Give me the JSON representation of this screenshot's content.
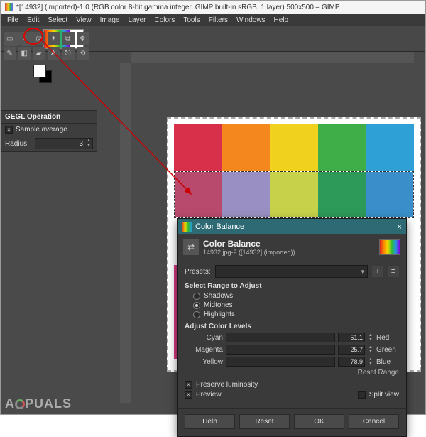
{
  "window": {
    "title": "*[14932] (imported)-1.0 (RGB color 8-bit gamma integer, GIMP built-in sRGB, 1 layer) 500x500 – GIMP"
  },
  "menu": [
    "File",
    "Edit",
    "Select",
    "View",
    "Image",
    "Layer",
    "Colors",
    "Tools",
    "Filters",
    "Windows",
    "Help"
  ],
  "panel": {
    "title": "GEGL Operation",
    "sample_avg": "Sample average",
    "radius_label": "Radius",
    "radius_value": "3"
  },
  "dialog": {
    "title": "Color Balance",
    "heading": "Color Balance",
    "subtitle": "14932.jpg-2 ([14932] (imported))",
    "presets_label": "Presets:",
    "range_label": "Select Range to Adjust",
    "shadows": "Shadows",
    "midtones": "Midtones",
    "highlights": "Highlights",
    "adjust_label": "Adjust Color Levels",
    "cyan": "Cyan",
    "red": "Red",
    "cyan_val": "-51.1",
    "magenta": "Magenta",
    "green": "Green",
    "mag_val": "25.7",
    "yellow": "Yellow",
    "blue": "Blue",
    "yel_val": "78.9",
    "reset_range": "Reset Range",
    "preserve": "Preserve luminosity",
    "preview": "Preview",
    "split": "Split view",
    "help": "Help",
    "reset": "Reset",
    "ok": "OK",
    "cancel": "Cancel"
  },
  "watermark": "A  PUALS"
}
